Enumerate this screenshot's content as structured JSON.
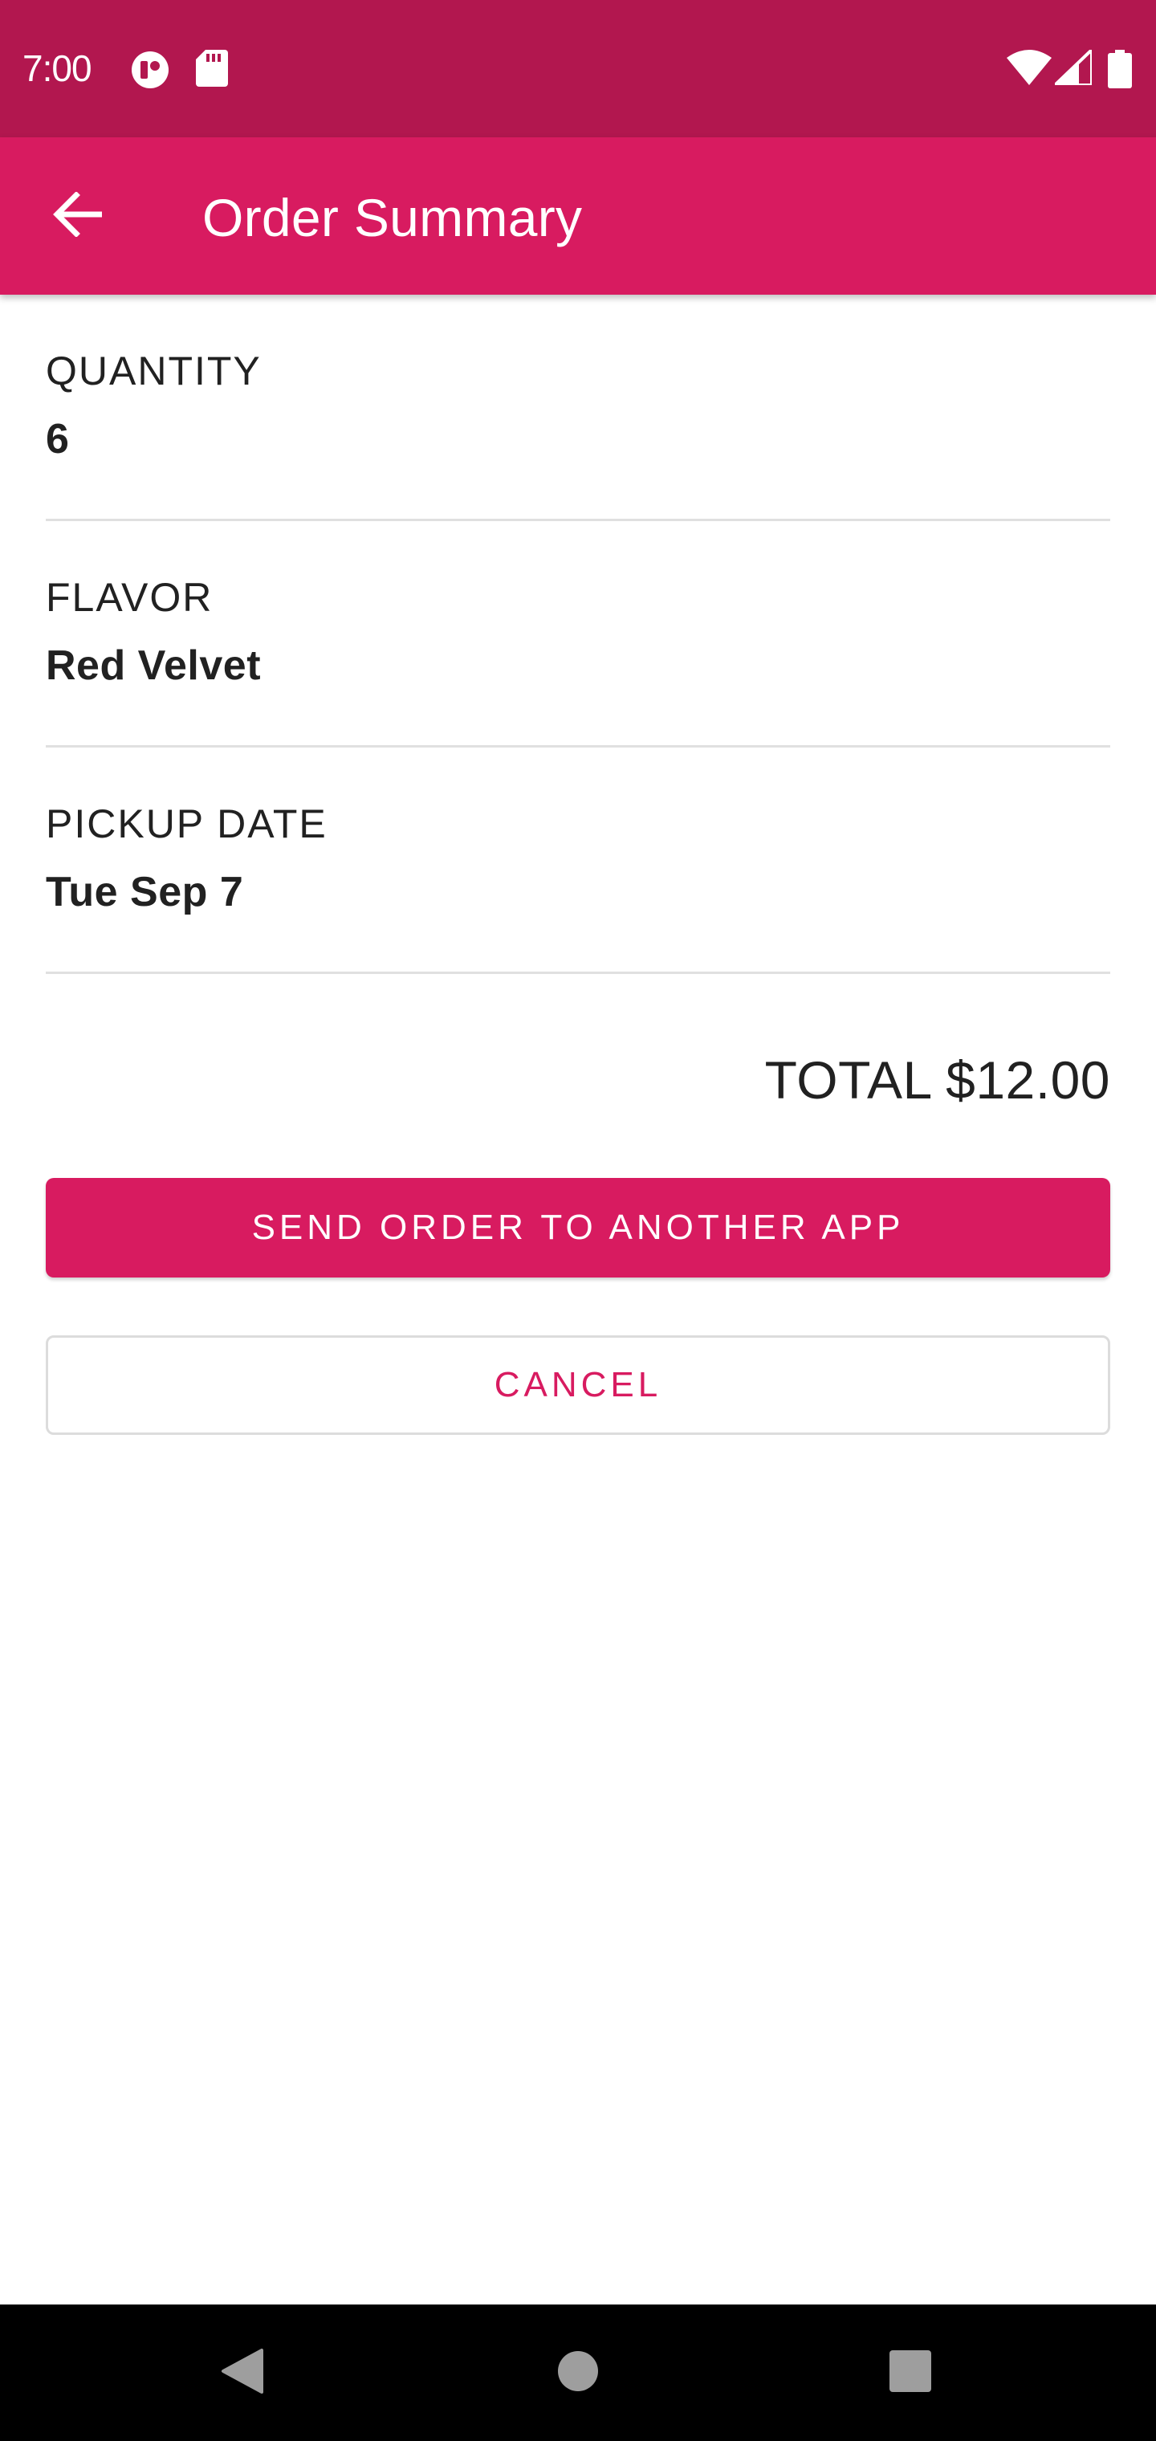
{
  "status_bar": {
    "time": "7:00",
    "left_icons": [
      "data-saver-icon",
      "sd-card-icon"
    ],
    "right_icons": [
      "wifi-icon",
      "signal-icon",
      "battery-icon"
    ],
    "background": "#b2174f"
  },
  "app_bar": {
    "title": "Order Summary",
    "back_icon": "arrow-back-icon",
    "background": "#d81b60"
  },
  "summary": {
    "quantity": {
      "label": "QUANTITY",
      "value": "6"
    },
    "flavor": {
      "label": "FLAVOR",
      "value": "Red Velvet"
    },
    "pickup_date": {
      "label": "PICKUP DATE",
      "value": "Tue Sep 7"
    },
    "total": "TOTAL $12.00"
  },
  "actions": {
    "send_label": "SEND ORDER TO ANOTHER APP",
    "cancel_label": "CANCEL"
  },
  "nav_bar": {
    "buttons": [
      "back-triangle-icon",
      "home-circle-icon",
      "recents-square-icon"
    ]
  },
  "colors": {
    "accent": "#d81b60",
    "status_bar": "#b2174f",
    "divider": "#e0e0e0"
  }
}
